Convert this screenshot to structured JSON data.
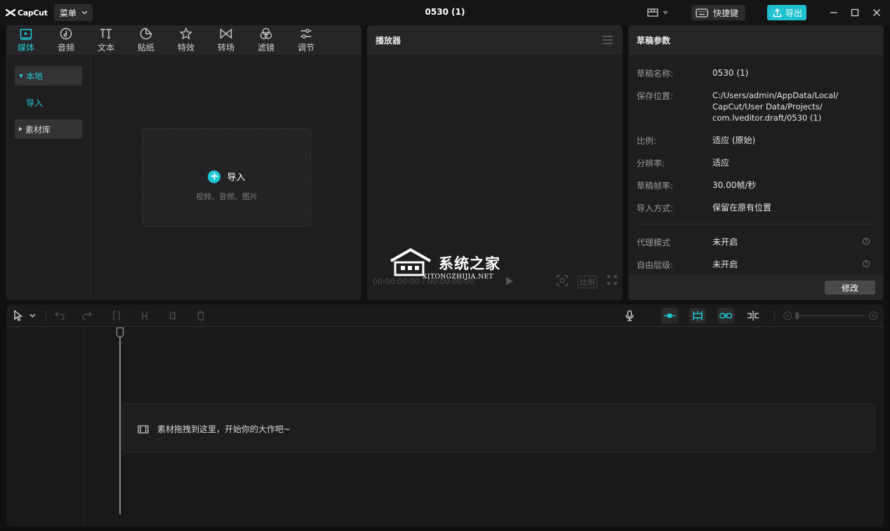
{
  "app": {
    "logo_text": "CapCut",
    "menu_label": "菜单",
    "title": "0530 (1)",
    "shortcut_label": "快捷键",
    "export_label": "导出",
    "accent_color": "#1fc0cf"
  },
  "media_panel": {
    "tabs": [
      {
        "label": "媒体",
        "icon": "media-icon",
        "active": true
      },
      {
        "label": "音频",
        "icon": "audio-icon"
      },
      {
        "label": "文本",
        "icon": "text-icon"
      },
      {
        "label": "贴纸",
        "icon": "sticker-icon"
      },
      {
        "label": "特效",
        "icon": "effects-icon"
      },
      {
        "label": "转场",
        "icon": "transition-icon"
      },
      {
        "label": "滤镜",
        "icon": "filter-icon"
      },
      {
        "label": "调节",
        "icon": "adjust-icon"
      }
    ],
    "sidebar": {
      "local": "本地",
      "import": "导入",
      "library": "素材库"
    },
    "dropzone": {
      "title": "导入",
      "subtitle": "视频、音频、图片"
    }
  },
  "player": {
    "title": "播放器",
    "timecode": "00:00:00:00 / 00:00:00:00",
    "ratio_label": "比例",
    "watermark_text": "系统之家",
    "watermark_sub": "XITONGZHIJIA.NET"
  },
  "draft": {
    "title": "草稿参数",
    "rows": [
      {
        "label": "草稿名称:",
        "value": "0530 (1)"
      },
      {
        "label": "保存位置:",
        "value": "C:/Users/admin/AppData/Local/\nCapCut/User Data/Projects/\ncom.lveditor.draft/0530 (1)"
      },
      {
        "label": "比例:",
        "value": "适应 (原始)"
      },
      {
        "label": "分辨率:",
        "value": "适应"
      },
      {
        "label": "草稿帧率:",
        "value": "30.00帧/秒"
      },
      {
        "label": "导入方式:",
        "value": "保留在原有位置"
      },
      {
        "label": "代理模式",
        "value": "未开启"
      },
      {
        "label": "自由层级:",
        "value": "未开启"
      }
    ],
    "modify_label": "修改"
  },
  "timeline": {
    "drop_message": "素材拖拽到这里，开始你的大作吧~"
  }
}
